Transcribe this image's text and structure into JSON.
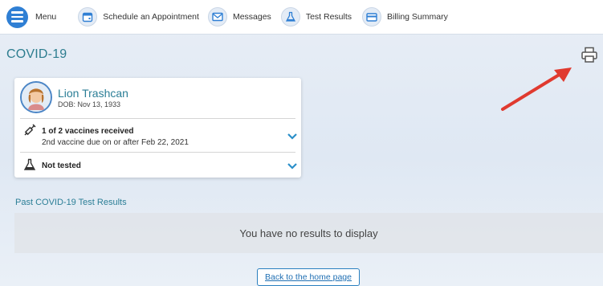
{
  "nav": {
    "menu_label": "Menu",
    "items": [
      {
        "label": "Schedule an Appointment",
        "icon": "calendar-icon"
      },
      {
        "label": "Messages",
        "icon": "envelope-icon"
      },
      {
        "label": "Test Results",
        "icon": "flask-icon"
      },
      {
        "label": "Billing Summary",
        "icon": "credit-card-icon"
      }
    ]
  },
  "page": {
    "title": "COVID-19",
    "print_icon": "printer-icon"
  },
  "patient": {
    "name": "Lion Trashcan",
    "dob": "DOB: Nov 13, 1933",
    "vaccine_status": "1 of 2 vaccines received",
    "vaccine_detail": "2nd vaccine due on or after Feb 22, 2021",
    "test_status": "Not tested"
  },
  "results": {
    "section_title": "Past COVID-19 Test Results",
    "empty_message": "You have no results to display"
  },
  "footer": {
    "home_link": "Back to the home page"
  },
  "colors": {
    "accent": "#2d7d8f",
    "menu_blue": "#2f7fd4",
    "arrow_red": "#e03a2f"
  }
}
